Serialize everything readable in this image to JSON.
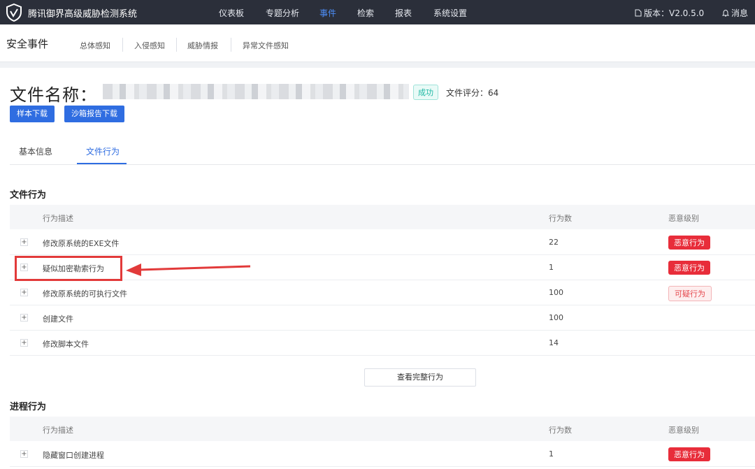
{
  "app": {
    "title": "腾讯御界高级威胁检测系统",
    "nav": [
      "仪表板",
      "专题分析",
      "事件",
      "检索",
      "报表",
      "系统设置"
    ],
    "active_nav": "事件",
    "version": "版本：V2.0.5.0",
    "messages": "消息"
  },
  "subheader": {
    "title": "安全事件",
    "tabs": [
      "总体感知",
      "入侵感知",
      "威胁情报",
      "异常文件感知"
    ]
  },
  "file": {
    "name_label": "文件名称：",
    "status": "成功",
    "score": "文件评分：64",
    "buttons": [
      "样本下载",
      "沙箱报告下载"
    ]
  },
  "tabs": [
    "基本信息",
    "文件行为"
  ],
  "active_tab": "文件行为",
  "file_behavior": {
    "title": "文件行为",
    "columns": [
      "行为描述",
      "行为数",
      "恶意级别"
    ],
    "rows": [
      {
        "desc": "修改原系统的EXE文件",
        "count": "22",
        "level": "恶意行为",
        "level_type": "malicious"
      },
      {
        "desc": "疑似加密勒索行为",
        "count": "1",
        "level": "恶意行为",
        "level_type": "malicious"
      },
      {
        "desc": "修改原系统的可执行文件",
        "count": "100",
        "level": "可疑行为",
        "level_type": "suspicious"
      },
      {
        "desc": "创建文件",
        "count": "100",
        "level": "",
        "level_type": "none"
      },
      {
        "desc": "修改脚本文件",
        "count": "14",
        "level": "",
        "level_type": "none"
      }
    ],
    "view_all": "查看完整行为"
  },
  "process_behavior": {
    "title": "进程行为",
    "columns": [
      "行为描述",
      "行为数",
      "恶意级别"
    ],
    "rows": [
      {
        "desc": "隐藏窗口创建进程",
        "count": "1",
        "level": "恶意行为",
        "level_type": "malicious"
      }
    ]
  },
  "colors": {
    "nav_bg": "#2b2f3a",
    "primary": "#2f6de1",
    "danger": "#e82d3a",
    "success": "#1fb8a4",
    "annotation": "#e23a3a"
  }
}
